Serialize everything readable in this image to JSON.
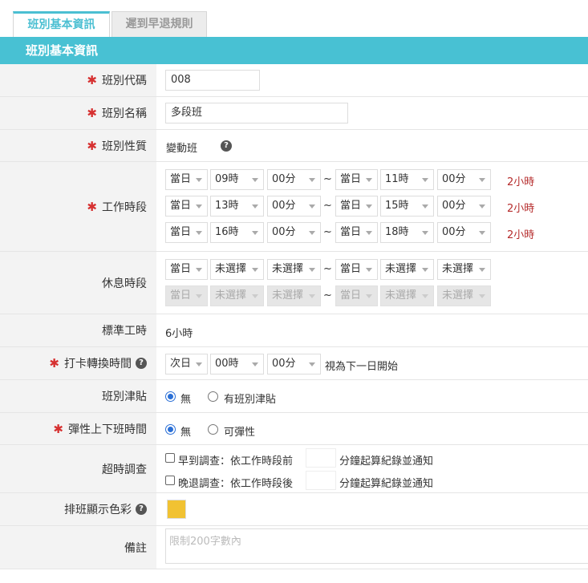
{
  "tabs": [
    {
      "label": "班別基本資訊",
      "active": true
    },
    {
      "label": "遲到早退規則",
      "active": false
    }
  ],
  "section_title": "班別基本資訊",
  "fields": {
    "code": {
      "label": "班別代碼",
      "value": "008"
    },
    "name": {
      "label": "班別名稱",
      "value": "多段班"
    },
    "nature": {
      "label": "班別性質",
      "value": "變動班"
    },
    "work": {
      "label": "工作時段",
      "rows": [
        {
          "d1": "當日",
          "h1": "09時",
          "m1": "00分",
          "d2": "當日",
          "h2": "11時",
          "m2": "00分",
          "dur": "2小時"
        },
        {
          "d1": "當日",
          "h1": "13時",
          "m1": "00分",
          "d2": "當日",
          "h2": "15時",
          "m2": "00分",
          "dur": "2小時"
        },
        {
          "d1": "當日",
          "h1": "16時",
          "m1": "00分",
          "d2": "當日",
          "h2": "18時",
          "m2": "00分",
          "dur": "2小時"
        }
      ]
    },
    "rest": {
      "label": "休息時段",
      "rows": [
        {
          "d1": "當日",
          "h1": "未選擇",
          "m1": "未選擇",
          "d2": "當日",
          "h2": "未選擇",
          "m2": "未選擇"
        },
        {
          "d1": "當日",
          "h1": "未選擇",
          "m1": "未選擇",
          "d2": "當日",
          "h2": "未選擇",
          "m2": "未選擇"
        }
      ]
    },
    "std_hours": {
      "label": "標準工時",
      "value": "6小時"
    },
    "punch": {
      "label": "打卡轉換時間",
      "day": "次日",
      "hour": "00時",
      "minute": "00分",
      "suffix": "視為下一日開始"
    },
    "allowance": {
      "label": "班別津貼",
      "opt1": "無",
      "opt2": "有班別津貼"
    },
    "flex": {
      "label": "彈性上下班時間",
      "opt1": "無",
      "opt2": "可彈性"
    },
    "overtime": {
      "label": "超時調查",
      "early": {
        "prefix": "早到調查：依工作時段前",
        "suffix": "分鐘起算紀錄並通知"
      },
      "late": {
        "prefix": "晚退調查：依工作時段後",
        "suffix": "分鐘起算紀錄並通知"
      }
    },
    "color": {
      "label": "排班顯示色彩",
      "value": "#f1c232"
    },
    "remark": {
      "label": "備註",
      "placeholder": "限制200字數內"
    }
  },
  "required_mark": "✱",
  "help_icon": "?",
  "tilde": "~"
}
